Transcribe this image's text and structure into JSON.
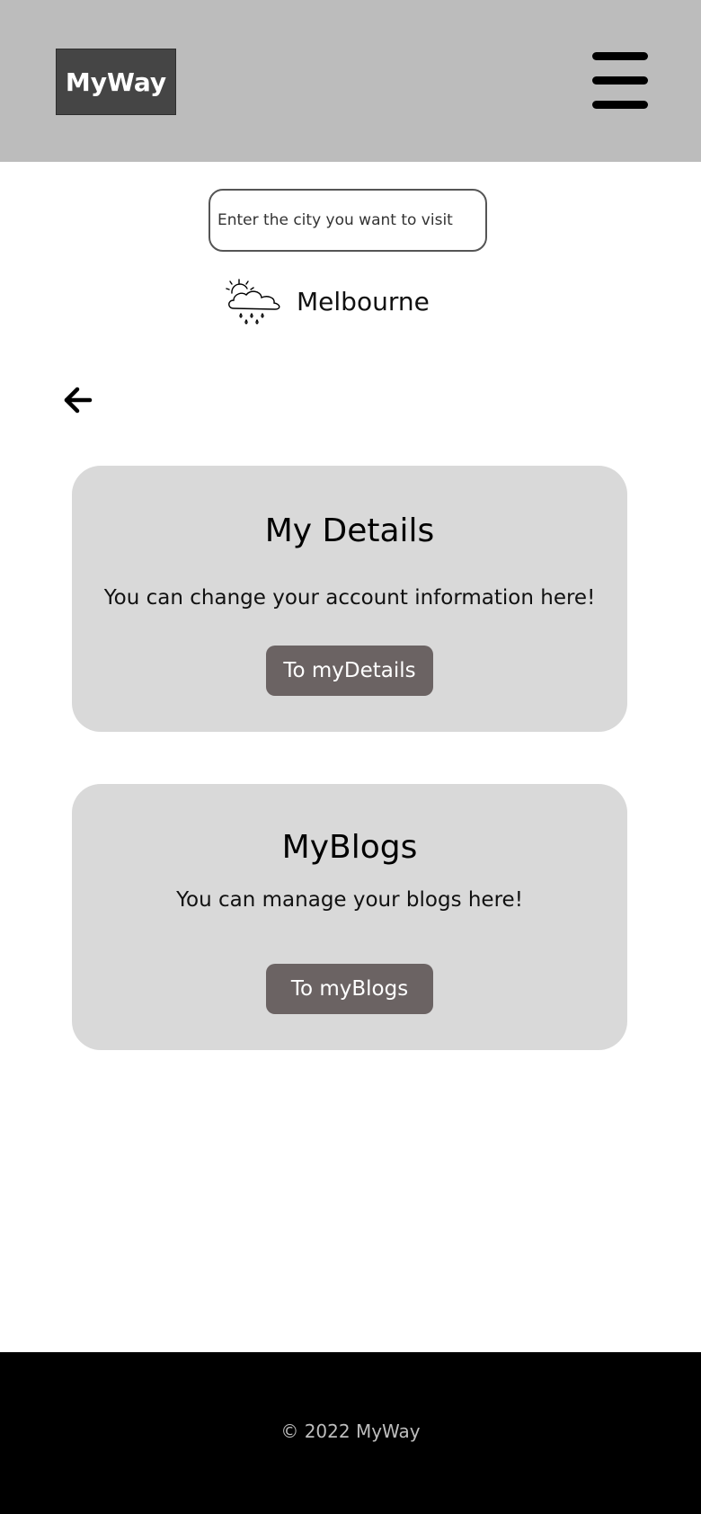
{
  "header": {
    "logo_text": "MyWay",
    "menu_icon": "hamburger-menu-icon"
  },
  "search": {
    "placeholder": "Enter the city you want to visit",
    "value": ""
  },
  "weather": {
    "icon": "cloud-sun-rain-icon",
    "city": "Melbourne"
  },
  "nav": {
    "back_icon": "arrow-left-icon"
  },
  "cards": [
    {
      "title": "My Details",
      "description": "You can change your account information here!",
      "button_label": "To myDetails"
    },
    {
      "title": "MyBlogs",
      "description": "You can manage your blogs here!",
      "button_label": "To myBlogs"
    }
  ],
  "footer": {
    "copyright": "© 2022 MyWay"
  },
  "colors": {
    "header_bg": "#bcbcbc",
    "logo_bg": "#454545",
    "card_bg": "#d9d9d9",
    "button_bg": "#6b6363",
    "footer_bg": "#000000"
  }
}
